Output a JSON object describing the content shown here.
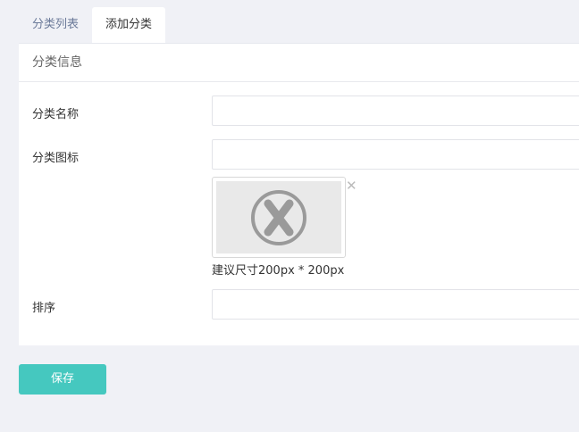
{
  "tabs": [
    {
      "label": "分类列表",
      "active": false
    },
    {
      "label": "添加分类",
      "active": true
    }
  ],
  "panel": {
    "title": "分类信息",
    "fields": {
      "name_label": "分类名称",
      "name_value": "",
      "icon_label": "分类图标",
      "icon_value": "",
      "icon_hint": "建议尺寸200px * 200px",
      "sort_label": "排序",
      "sort_value": ""
    }
  },
  "icons": {
    "image_placeholder": "x-circle-icon",
    "remove": "close-icon"
  },
  "save_label": "保存",
  "colors": {
    "accent": "#45c8bf",
    "background": "#f0f1f6"
  }
}
